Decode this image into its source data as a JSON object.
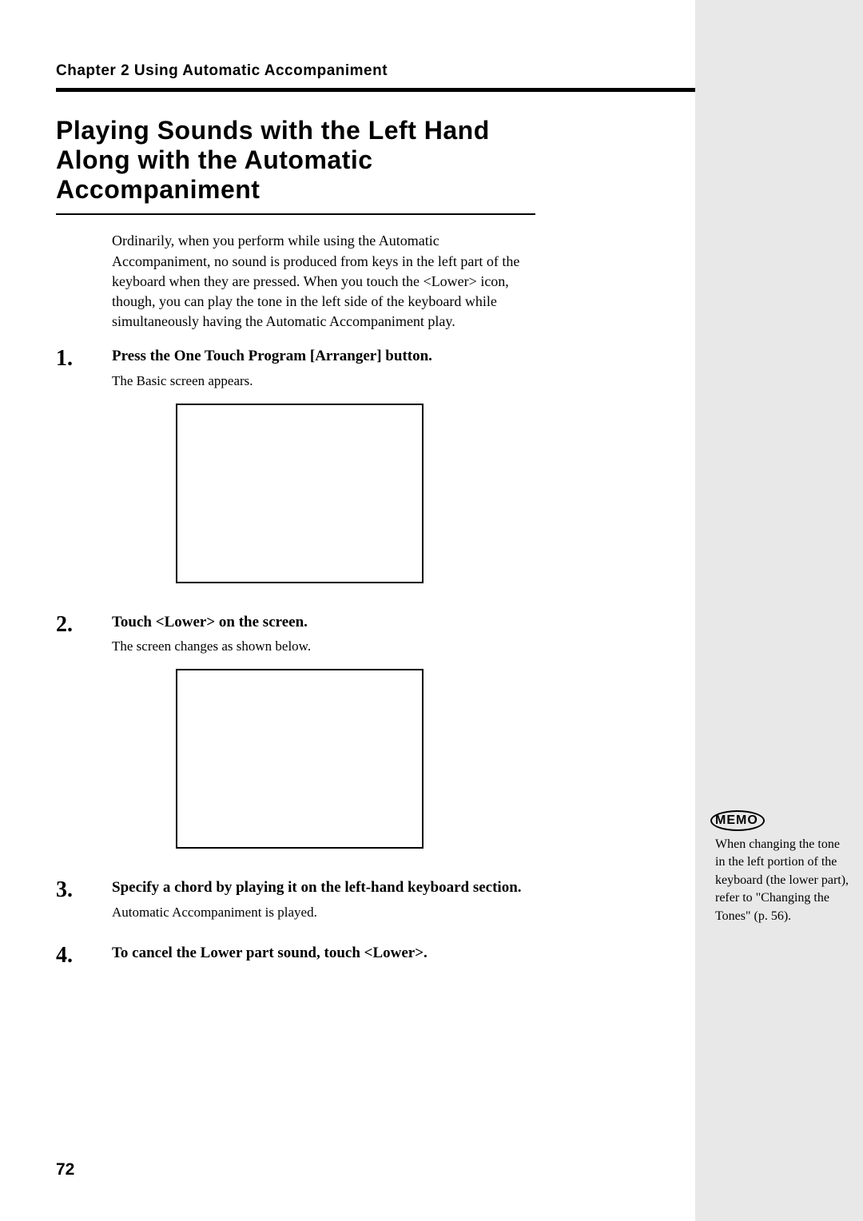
{
  "chapter_header": "Chapter 2 Using Automatic Accompaniment",
  "section_title": "Playing Sounds with the Left Hand Along with the Automatic Accompaniment",
  "intro": "Ordinarily, when you perform while using the Automatic Accompaniment, no sound is produced from keys in the left part of the keyboard when they are pressed. When you touch the <Lower> icon, though, you can play the tone in the left side of the keyboard while simultaneously having the Automatic Accompaniment play.",
  "steps": [
    {
      "num": "1.",
      "instruction": "Press the One Touch Program [Arranger] button.",
      "sub": "The Basic screen appears."
    },
    {
      "num": "2.",
      "instruction": "Touch <Lower> on the screen.",
      "sub": "The screen changes as shown below."
    },
    {
      "num": "3.",
      "instruction": "Specify a chord by playing it on the left-hand keyboard section.",
      "sub": "Automatic Accompaniment is played."
    },
    {
      "num": "4.",
      "instruction": "To cancel the Lower part sound, touch <Lower>.",
      "sub": ""
    }
  ],
  "memo": {
    "label": "MEMO",
    "text": "When changing the tone in the left portion of the keyboard (the lower part), refer to \"Changing the Tones\" (p. 56)."
  },
  "page_number": "72"
}
